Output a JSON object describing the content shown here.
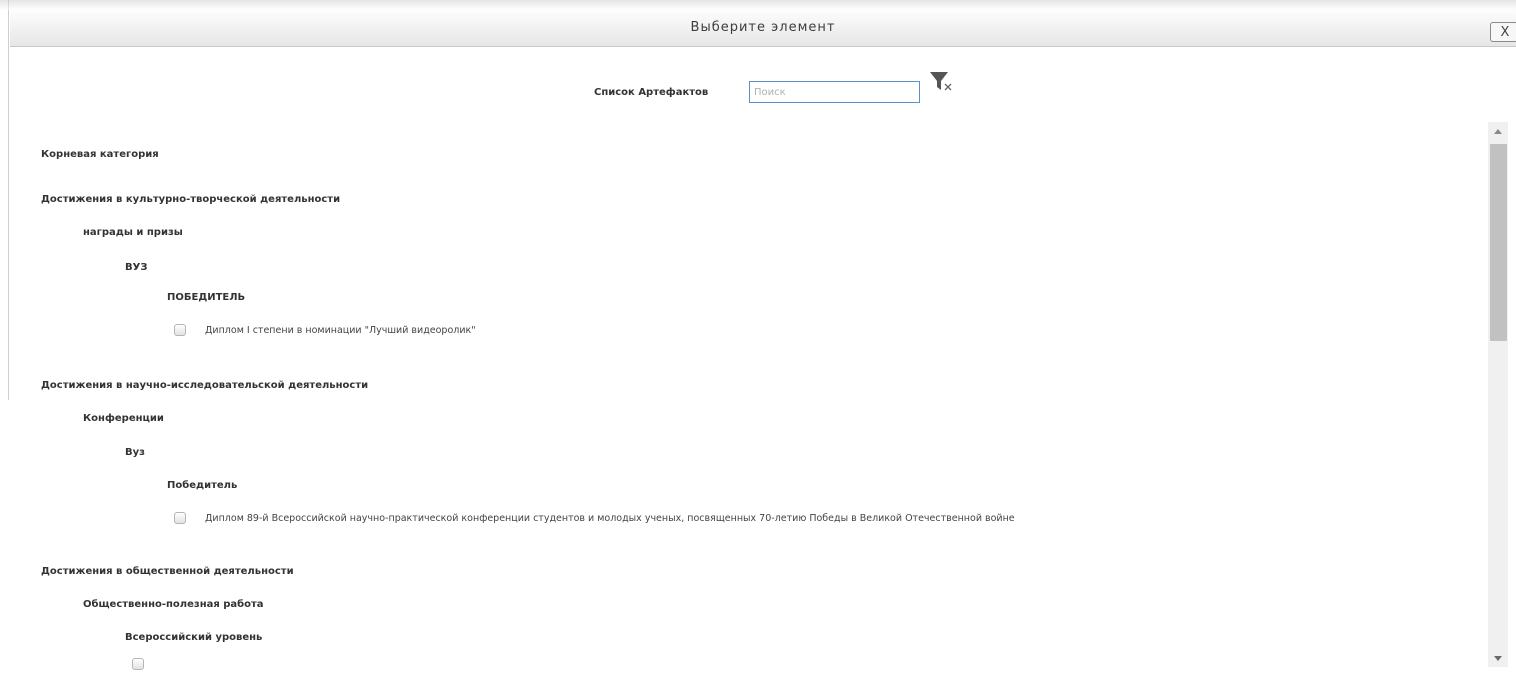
{
  "dialog": {
    "title": "Выберите элемент",
    "close_label": "X"
  },
  "search": {
    "label": "Список Артефактов",
    "placeholder": "Поиск",
    "value": ""
  },
  "icons": {
    "close": "close-icon",
    "filter_clear": "filter-clear-icon",
    "scroll_up": "arrow-up-icon",
    "scroll_down": "arrow-down-icon"
  },
  "tree": {
    "root": "Корневая категория",
    "cat1": {
      "label": "Достижения в культурно-творческой деятельности",
      "sub": "награды и призы",
      "level": "ВУЗ",
      "status": "ПОБЕДИТЕЛЬ",
      "item": "Диплом I степени в номинации \"Лучший видеоролик\""
    },
    "cat2": {
      "label": "Достижения в научно-исследовательской деятельности",
      "sub": "Конференции",
      "level": "Вуз",
      "status": "Победитель",
      "item": "Диплом 89-й Всероссийской научно-практической конференции студентов и молодых ученых, посвященных 70-летию Победы в Великой Отечественной войне"
    },
    "cat3": {
      "label": "Достижения в общественной деятельности",
      "sub": "Общественно-полезная работа",
      "level": "Всероссийский уровень"
    }
  },
  "colors": {
    "input_border": "#5a8fc7",
    "title_text": "#3d3d3d",
    "scroll_thumb": "#c1c1c1"
  }
}
